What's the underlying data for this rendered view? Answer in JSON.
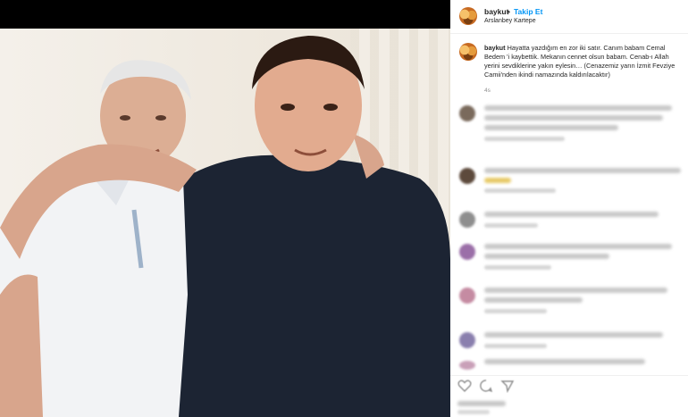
{
  "header": {
    "username": "baykut",
    "separator": "•",
    "follow_label": "Takip Et",
    "location": "Arslanbey Kartepe"
  },
  "caption": {
    "username": "baykut",
    "text": "Hayatta yazdığım en zor iki satır. Canım babam Cemal Bedem 'i kaybettik. Mekanın cennet olsun babam. Cenab-ı Allah yerini sevdiklerine yakın eylesin… (Cenazemiz yarın İzmit Fevziye Camii'nden ikindi namazında kaldırılacaktır)",
    "time": "4s"
  },
  "comments": [
    {
      "lines": 3
    },
    {
      "lines": 1
    },
    {
      "lines": 1
    },
    {
      "lines": 1
    },
    {
      "lines": 2
    },
    {
      "lines": 1
    },
    {
      "lines": 1
    }
  ],
  "actions": {
    "icons": [
      "heart-icon",
      "comment-icon",
      "share-icon"
    ]
  },
  "colors": {
    "follow_blue": "#0095f6",
    "text": "#262626",
    "muted": "#8e8e8e"
  }
}
